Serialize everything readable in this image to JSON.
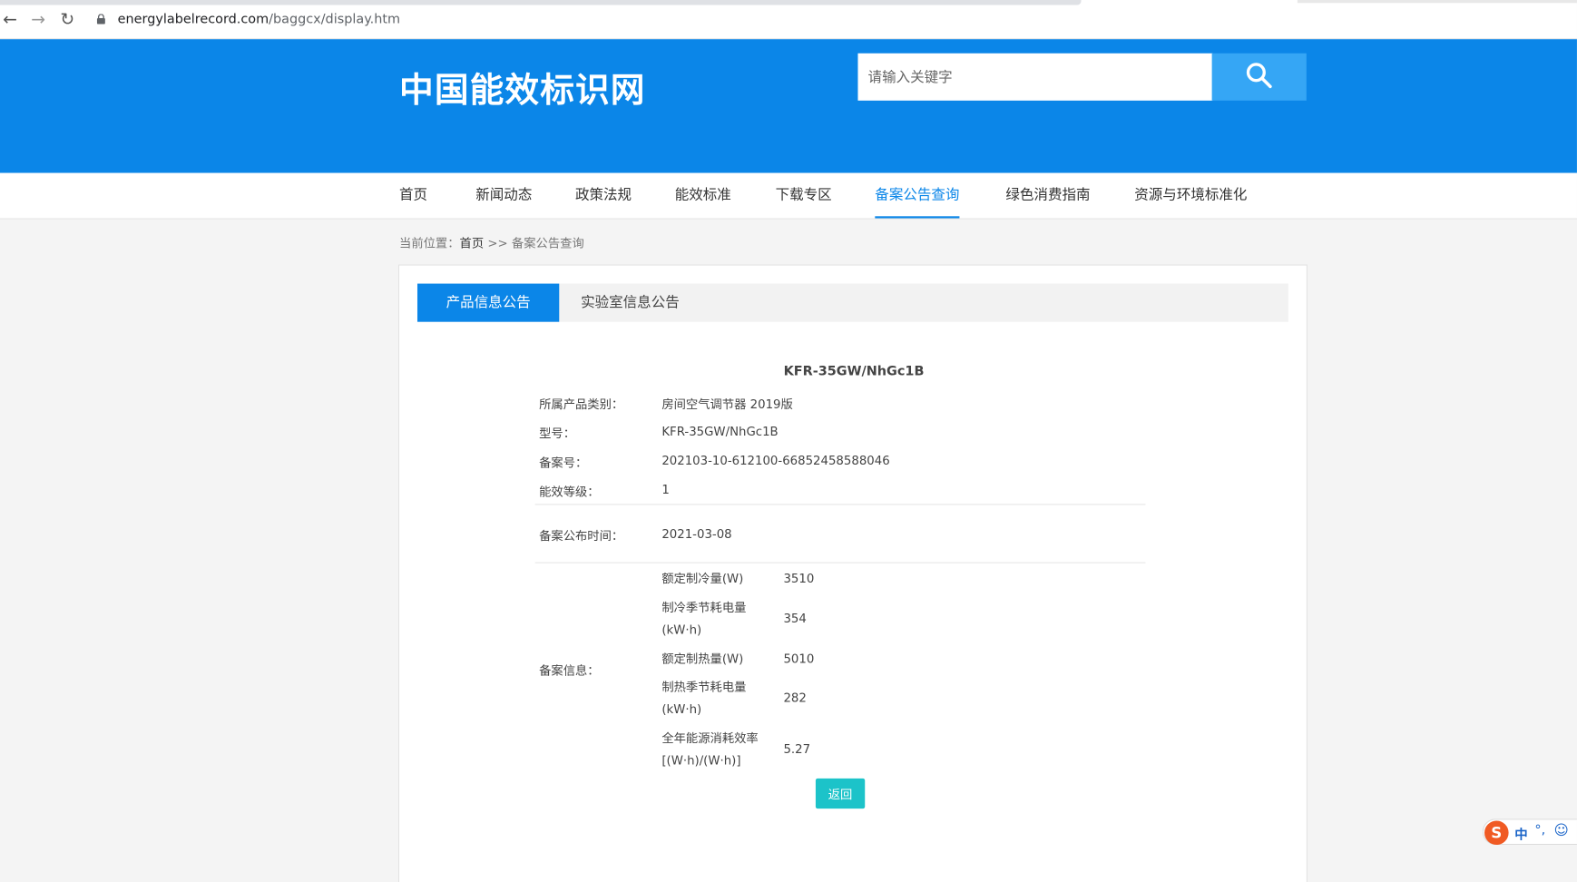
{
  "browser": {
    "url_host": "energylabelrecord.com",
    "url_path": "/baggcx/display.htm"
  },
  "header": {
    "logo": "中国能效标识网",
    "search_placeholder": "请输入关键字"
  },
  "nav": {
    "items": [
      "首页",
      "新闻动态",
      "政策法规",
      "能效标准",
      "下载专区",
      "备案公告查询",
      "绿色消费指南",
      "资源与环境标准化"
    ],
    "active_index": 5
  },
  "breadcrumb": {
    "prefix": "当前位置：",
    "home": "首页",
    "separator": " >> ",
    "current": "备案公告查询"
  },
  "tabs": {
    "active": "产品信息公告",
    "inactive": "实验室信息公告"
  },
  "product": {
    "title": "KFR-35GW/NhGc1B",
    "fields": [
      {
        "label": "所属产品类别：",
        "value": "房间空气调节器 2019版"
      },
      {
        "label": "型号：",
        "value": "KFR-35GW/NhGc1B"
      },
      {
        "label": "备案号：",
        "value": "202103-10-612100-66852458588046"
      },
      {
        "label": "能效等级：",
        "value": "1"
      }
    ],
    "publish_time_label": "备案公布时间：",
    "publish_time_value": "2021-03-08",
    "record_info_label": "备案信息：",
    "specs": [
      {
        "name": [
          "额定制冷量(W)"
        ],
        "value": "3510"
      },
      {
        "name": [
          "制冷季节耗电量",
          "(kW·h)"
        ],
        "value": "354"
      },
      {
        "name": [
          "额定制热量(W)"
        ],
        "value": "5010"
      },
      {
        "name": [
          "制热季节耗电量",
          "(kW·h)"
        ],
        "value": "282"
      },
      {
        "name": [
          "全年能源消耗效率",
          "[(W·h)/(W·h)]"
        ],
        "value": "5.27"
      }
    ],
    "back_label": "返回"
  },
  "ime": {
    "logo": "S",
    "mode": "中",
    "punct": "°,",
    "emoji": "☺"
  }
}
